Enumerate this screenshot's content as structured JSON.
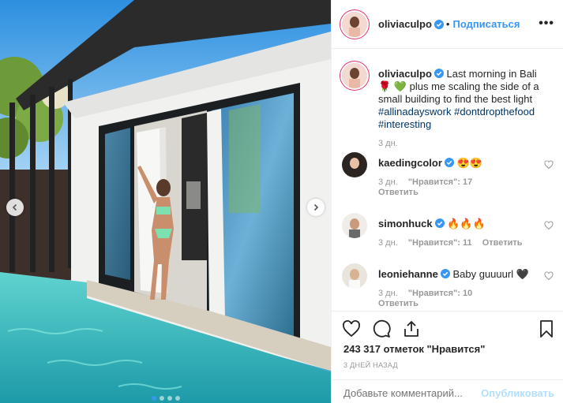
{
  "post": {
    "author": "oliviaculpo",
    "header_separator": "•",
    "follow_label": "Подписаться",
    "more_label": "•••",
    "caption_parts": {
      "text1": "Last morning in Bali",
      "emoji1": "🌹",
      "emoji2": "💚",
      "text2": "plus me scaling the side of a small building to find the best light",
      "tag1": "#allinadayswork",
      "tag2": "#dontdropthefood",
      "tag3": "#interesting"
    },
    "caption_time": "3 дн.",
    "likes": "243 317 отметок \"Нравится\"",
    "date": "3 ДНЕЙ НАЗАД",
    "add_comment_placeholder": "Добавьте комментарий...",
    "publish_label": "Опубликовать",
    "carousel": {
      "dots": 4,
      "active_index": 0
    }
  },
  "comments": [
    {
      "username": "kaedingcolor",
      "verified": true,
      "text": "😍😍",
      "time": "3 дн.",
      "likes": "\"Нравится\": 17",
      "reply": "Ответить"
    },
    {
      "username": "simonhuck",
      "verified": true,
      "text": "🔥🔥🔥",
      "time": "3 дн.",
      "likes": "\"Нравится\": 11",
      "reply": "Ответить"
    },
    {
      "username": "leoniehanne",
      "verified": true,
      "text": "Baby guuuurl 🖤",
      "time": "3 дн.",
      "likes": "\"Нравится\": 10",
      "reply": "Ответить"
    }
  ],
  "colors": {
    "accent": "#3897f0",
    "verified": "#3897f0",
    "muted": "#999999",
    "border": "#efefef"
  },
  "icons": [
    "prev-arrow-icon",
    "next-arrow-icon",
    "more-icon",
    "verified-icon",
    "heart-icon",
    "comment-icon",
    "share-icon",
    "bookmark-icon"
  ]
}
